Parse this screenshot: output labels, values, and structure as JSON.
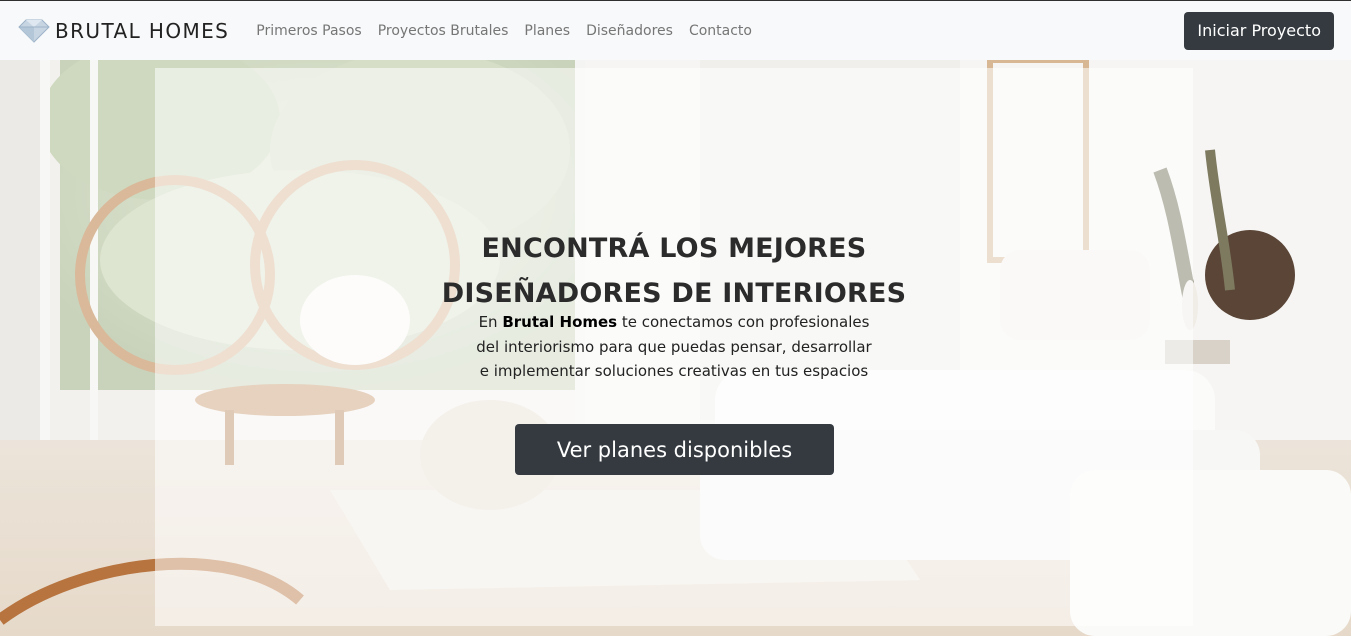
{
  "navbar": {
    "brand_icon": "diamond-icon",
    "brand_text": "BRUTAL HOMES",
    "links": [
      "Primeros Pasos",
      "Proyectos Brutales",
      "Planes",
      "Diseñadores",
      "Contacto"
    ],
    "cta_label": "Iniciar Proyecto"
  },
  "hero": {
    "title_line1": "ENCONTRÁ LOS MEJORES",
    "title_line2": "DISEÑADORES DE INTERIORES",
    "desc_prefix": "En ",
    "desc_brand": "Brutal Homes",
    "desc_rest1": " te conectamos con profesionales",
    "desc_line2": "del interiorismo para que puedas pensar, desarrollar",
    "desc_line3": "e implementar soluciones creativas en tus espacios",
    "cta_label": "Ver planes disponibles"
  },
  "colors": {
    "navbar_bg": "#f8f9fa",
    "button_dark": "#343a40",
    "nav_link": "#767676",
    "title_text": "#2b2b2b"
  }
}
